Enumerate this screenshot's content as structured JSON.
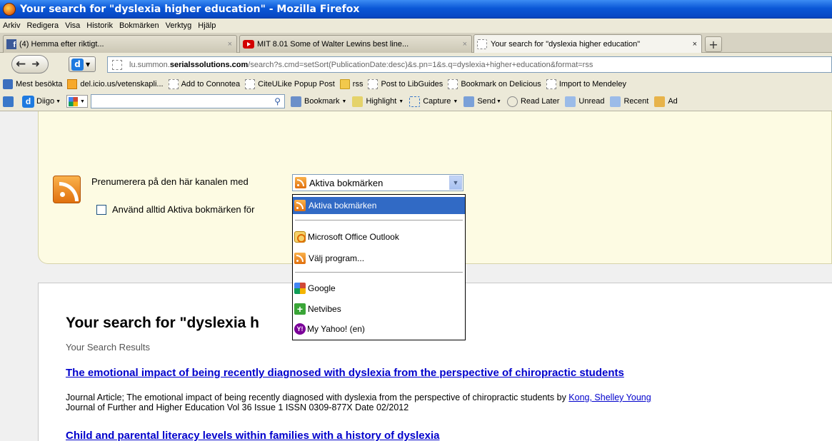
{
  "window": {
    "title": "Your search for \"dyslexia higher education\" - Mozilla Firefox"
  },
  "menu": {
    "items": [
      "Arkiv",
      "Redigera",
      "Visa",
      "Historik",
      "Bokmärken",
      "Verktyg",
      "Hjälp"
    ]
  },
  "tabs": [
    {
      "label": "(4) Hemma efter riktigt...",
      "close": "×",
      "icon": "facebook-icon"
    },
    {
      "label": "MIT 8.01 Some of Walter Lewins best line...",
      "close": "×",
      "icon": "youtube-icon"
    },
    {
      "label": "Your search for \"dyslexia higher education\"",
      "close": "×",
      "icon": "blank-page-icon"
    }
  ],
  "new_tab_label": "+",
  "nav": {
    "url_prefix": "lu.summon.",
    "url_domain": "serialssolutions.com",
    "url_rest": "/search?s.cmd=setSort(PublicationDate:desc)&s.pn=1&s.q=dyslexia+higher+education&format=rss"
  },
  "bookmarks": [
    {
      "label": "Mest besökta",
      "icon": "search"
    },
    {
      "label": "del.icio.us/vetenskapli...",
      "icon": "rss"
    },
    {
      "label": "Add to Connotea",
      "icon": "blank"
    },
    {
      "label": "CiteULike Popup Post",
      "icon": "blank"
    },
    {
      "label": "rss",
      "icon": "folder"
    },
    {
      "label": "Post to LibGuides",
      "icon": "blank"
    },
    {
      "label": "Bookmark on Delicious",
      "icon": "blank"
    },
    {
      "label": "Import to Mendeley",
      "icon": "blank"
    }
  ],
  "diigo": {
    "brand": "Diigo",
    "tools": [
      "Bookmark",
      "Highlight",
      "Capture",
      "Send",
      "Read Later",
      "Unread",
      "Recent",
      "Ad"
    ]
  },
  "feed": {
    "subscribe_label": "Prenumerera på den här kanalen med",
    "selected": "Aktiva bokmärken",
    "always_label": "Använd alltid Aktiva bokmärken för",
    "options": [
      {
        "label": "Aktiva bokmärken",
        "icon": "rss-icon"
      },
      {
        "label": "Microsoft Office Outlook",
        "icon": "outlook-icon"
      },
      {
        "label": "Välj program...",
        "icon": "rss-icon"
      },
      {
        "label": "Google",
        "icon": "google-icon"
      },
      {
        "label": "Netvibes",
        "icon": "netvibes-icon"
      },
      {
        "label": "My Yahoo! (en)",
        "icon": "yahoo-icon"
      }
    ]
  },
  "results": {
    "title": "Your search for \"dyslexia h",
    "subtitle": "Your Search Results",
    "items": [
      {
        "title": "The emotional impact of being recently diagnosed with dyslexia from the perspective of chiropractic students",
        "desc_line1": "Journal Article; The emotional impact of being recently diagnosed with dyslexia from the perspective of chiropractic students by ",
        "author": "Kong, Shelley Young",
        "desc_line2": "Journal of Further and Higher Education Vol 36 Issue 1 ISSN 0309-877X Date 02/2012"
      },
      {
        "title": "Child and parental literacy levels within families with a history of dyslexia"
      }
    ]
  }
}
